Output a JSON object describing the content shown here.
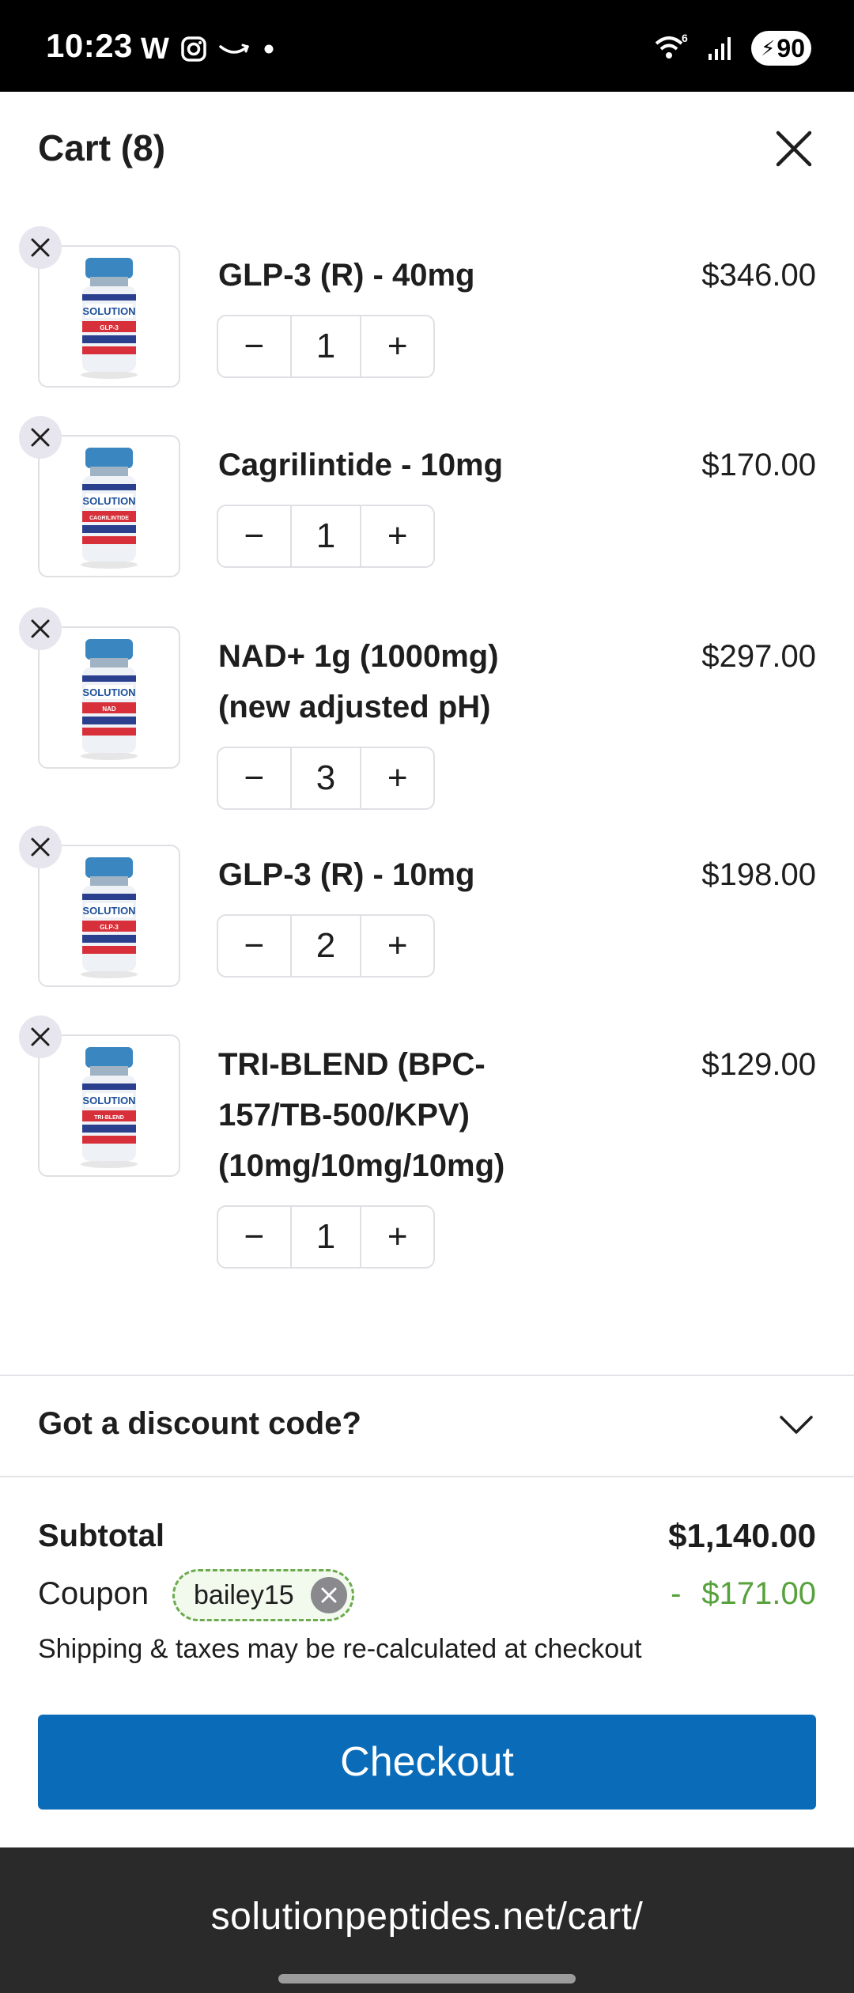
{
  "status_bar": {
    "time": "10:23",
    "app_w": "W",
    "network": "6",
    "battery": "90"
  },
  "header": {
    "title": "Cart (8)"
  },
  "items": [
    {
      "name": "GLP-3 (R) - 40mg",
      "price": "$346.00",
      "qty": "1",
      "vial_label": "GLP-3"
    },
    {
      "name": "Cagrilintide - 10mg",
      "price": "$170.00",
      "qty": "1",
      "vial_label": "CAGRILINTIDE"
    },
    {
      "name": "NAD+ 1g (1000mg) (new adjusted pH)",
      "price": "$297.00",
      "qty": "3",
      "vial_label": "NAD"
    },
    {
      "name": "GLP-3 (R) - 10mg",
      "price": "$198.00",
      "qty": "2",
      "vial_label": "GLP-3"
    },
    {
      "name": "TRI-BLEND (BPC-157/TB-500/KPV) (10mg/10mg/10mg)",
      "price": "$129.00",
      "qty": "1",
      "vial_label": "TRI-BLEND"
    }
  ],
  "stepper": {
    "minus": "−",
    "plus": "+"
  },
  "discount": {
    "label": "Got a discount code?"
  },
  "totals": {
    "subtotal_label": "Subtotal",
    "subtotal_value": "$1,140.00",
    "coupon_label": "Coupon",
    "coupon_code": "bailey15",
    "coupon_sign": "-",
    "coupon_value": "$171.00",
    "shipping_note": "Shipping & taxes may be re-calculated at checkout"
  },
  "checkout": {
    "label": "Checkout"
  },
  "browser": {
    "url": "solutionpeptides.net/cart/"
  },
  "colors": {
    "accent": "#0a6cb8",
    "coupon_green": "#58a23e",
    "status_bar": "#000000",
    "url_bar": "#2a2a2a"
  }
}
